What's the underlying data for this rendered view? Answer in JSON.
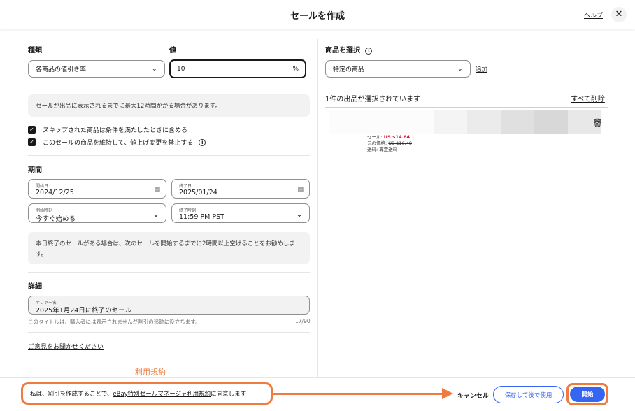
{
  "header": {
    "title": "セールを作成",
    "help": "ヘルプ",
    "close": "✕"
  },
  "left": {
    "type_label": "種類",
    "type_value": "各商品の値引き率",
    "value_label": "値",
    "value_input": "10",
    "value_unit": "%",
    "notice": "セールが出品に表示されるまでに最大12時間かかる場合があります。",
    "check1": "スキップされた商品は条件を満たしたときに含める",
    "check2": "このセールの商品を維持して、値上げ変更を禁止する",
    "period_label": "期間",
    "start_date_label": "開始日",
    "start_date": "2024/12/25",
    "end_date_label": "終了日",
    "end_date": "2025/01/24",
    "start_time_label": "開始時刻",
    "start_time": "今すぐ始める",
    "end_time_label": "終了時刻",
    "end_time": "11:59 PM PST",
    "period_notice": "本日終了のセールがある場合は、次のセールを開始するまでに2時間以上空けることをお勧めします。",
    "details_label": "詳細",
    "offer_label": "オファー名",
    "offer_value": "2025年1月24日に終了のセール",
    "offer_caption": "このタイトルは、購入者には表示されませんが割引の追跡に役立ちます。",
    "offer_count": "17/90",
    "feedback_link": "ご意見をお聞かせください"
  },
  "right": {
    "select_label": "商品を選択",
    "select_value": "特定の商品",
    "add_link": "追加",
    "selected_count": "1件の出品が選択されています",
    "remove_all": "すべて削除",
    "sale_price_label": "セール: ",
    "sale_price": "US $14.84",
    "orig_price_label": "元の価格: ",
    "orig_price": "US $16.49",
    "shipping": "送料: 算定送料"
  },
  "footer": {
    "terms_annotation": "利用規約",
    "agree_prefix": "私は、割引を作成することで、",
    "agree_link": "eBay特別セールマネージャ利用規約",
    "agree_suffix": "に同意します",
    "cancel": "キャンセル",
    "save_later": "保存して後で使用",
    "start": "開始"
  },
  "colors": {
    "accent": "#3665f3",
    "annotation": "#f07b3f",
    "sale": "#e0103a"
  }
}
